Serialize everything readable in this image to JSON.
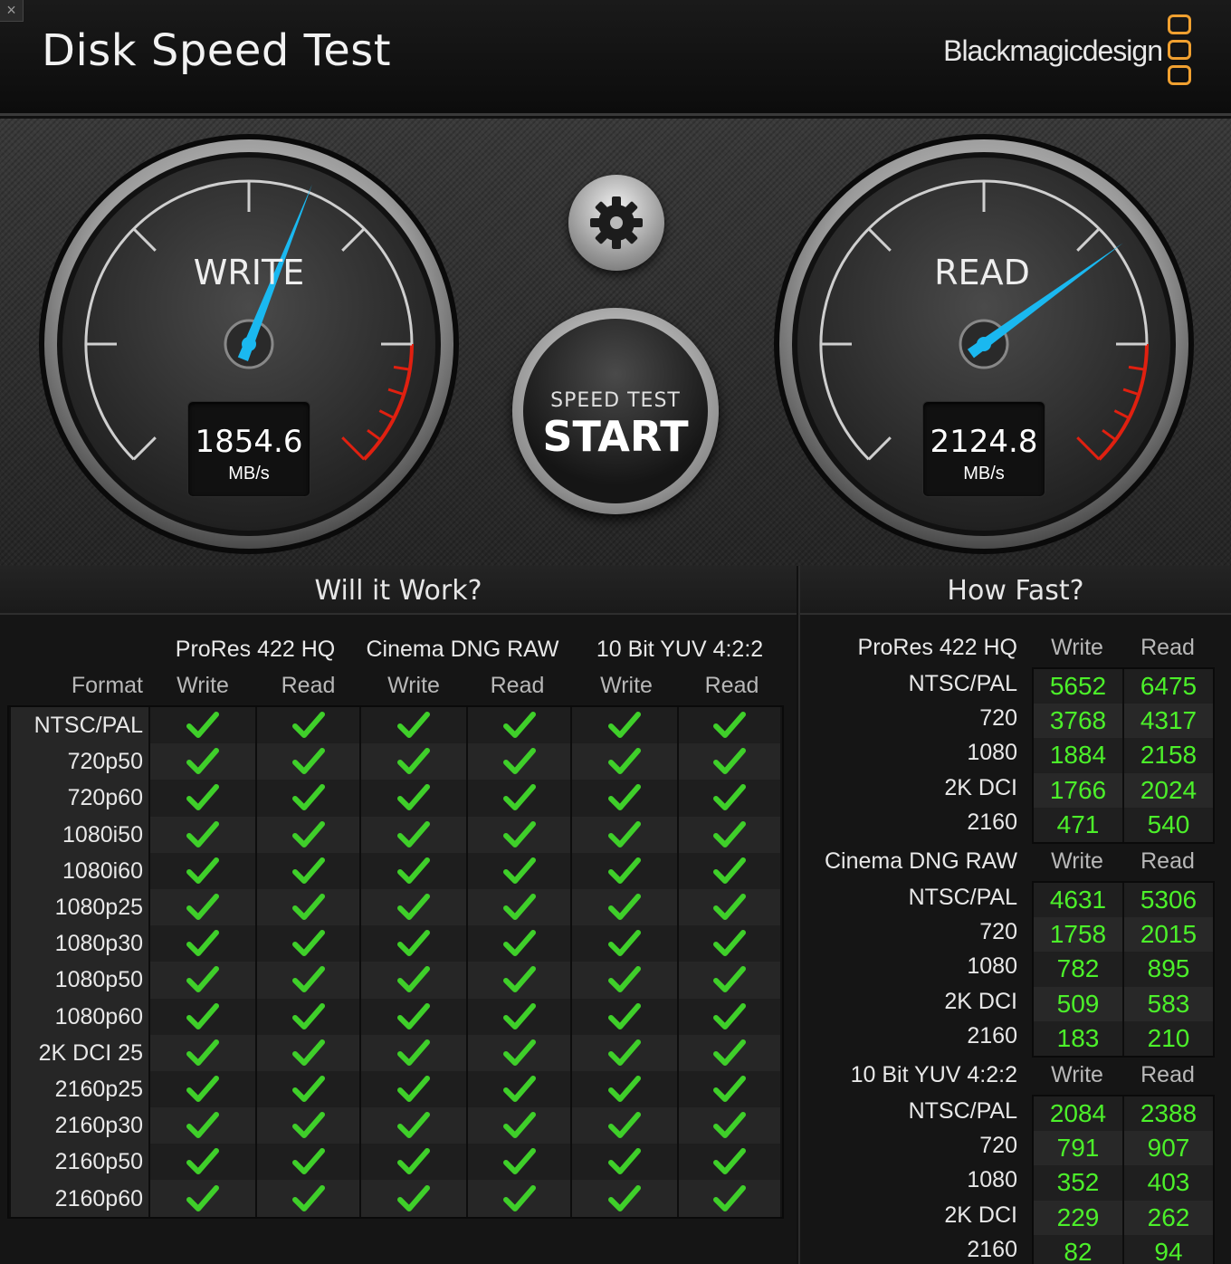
{
  "app": {
    "title": "Disk Speed Test",
    "brand": "Blackmagicdesign",
    "close": "×"
  },
  "gauges": {
    "write": {
      "label": "WRITE",
      "value": "1854.6",
      "unit": "MB/s",
      "needle_fraction": 0.58
    },
    "read": {
      "label": "READ",
      "value": "2124.8",
      "unit": "MB/s",
      "needle_fraction": 0.7
    }
  },
  "controls": {
    "settings_icon": "gear-icon",
    "start_small": "SPEED TEST",
    "start_big": "START"
  },
  "will_it_work": {
    "title": "Will it Work?",
    "format_label": "Format",
    "groups": [
      "ProRes 422 HQ",
      "Cinema DNG RAW",
      "10 Bit YUV 4:2:2"
    ],
    "columns": [
      "Write",
      "Read",
      "Write",
      "Read",
      "Write",
      "Read"
    ],
    "formats": [
      "NTSC/PAL",
      "720p50",
      "720p60",
      "1080i50",
      "1080i60",
      "1080p25",
      "1080p30",
      "1080p50",
      "1080p60",
      "2K DCI 25",
      "2160p25",
      "2160p30",
      "2160p50",
      "2160p60"
    ],
    "all_supported": true
  },
  "how_fast": {
    "title": "How Fast?",
    "sections": [
      {
        "name": "ProRes 422 HQ",
        "write_label": "Write",
        "read_label": "Read",
        "rows": [
          {
            "label": "NTSC/PAL",
            "write": "5652",
            "read": "6475"
          },
          {
            "label": "720",
            "write": "3768",
            "read": "4317"
          },
          {
            "label": "1080",
            "write": "1884",
            "read": "2158"
          },
          {
            "label": "2K DCI",
            "write": "1766",
            "read": "2024"
          },
          {
            "label": "2160",
            "write": "471",
            "read": "540"
          }
        ]
      },
      {
        "name": "Cinema DNG RAW",
        "write_label": "Write",
        "read_label": "Read",
        "rows": [
          {
            "label": "NTSC/PAL",
            "write": "4631",
            "read": "5306"
          },
          {
            "label": "720",
            "write": "1758",
            "read": "2015"
          },
          {
            "label": "1080",
            "write": "782",
            "read": "895"
          },
          {
            "label": "2K DCI",
            "write": "509",
            "read": "583"
          },
          {
            "label": "2160",
            "write": "183",
            "read": "210"
          }
        ]
      },
      {
        "name": "10 Bit YUV 4:2:2",
        "write_label": "Write",
        "read_label": "Read",
        "rows": [
          {
            "label": "NTSC/PAL",
            "write": "2084",
            "read": "2388"
          },
          {
            "label": "720",
            "write": "791",
            "read": "907"
          },
          {
            "label": "1080",
            "write": "352",
            "read": "403"
          },
          {
            "label": "2K DCI",
            "write": "229",
            "read": "262"
          },
          {
            "label": "2160",
            "write": "82",
            "read": "94"
          }
        ]
      }
    ]
  },
  "colors": {
    "needle": "#1ab8f0",
    "check": "#3fcf2a",
    "value_green": "#4cf02a",
    "brand_orange": "#f0a030",
    "redline": "#e02010"
  }
}
